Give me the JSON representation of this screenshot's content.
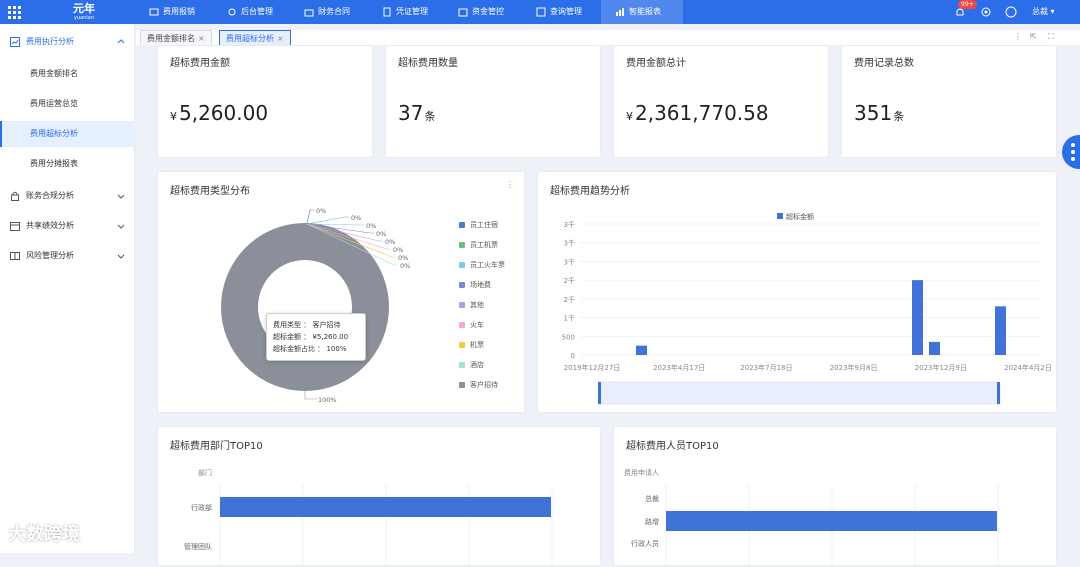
{
  "header": {
    "logo_text": "元年",
    "logo_sub": "yuanian",
    "nav": [
      "费用报销",
      "后台管理",
      "财务合同",
      "凭证管理",
      "资金管控",
      "查询管理",
      "智能报表"
    ],
    "badge": "99+",
    "user": "总裁"
  },
  "sidebar": {
    "groups": [
      {
        "label": "费用执行分析",
        "items": [
          "费用金额排名",
          "费用运营总览",
          "费用超标分析",
          "费用分摊报表"
        ]
      },
      {
        "label": "账务合规分析"
      },
      {
        "label": "共享绩效分析"
      },
      {
        "label": "风险管理分析"
      }
    ]
  },
  "tabs": [
    "费用金额排名",
    "费用超标分析"
  ],
  "kpis": [
    {
      "title": "超标费用金额",
      "currency": "¥",
      "value": "5,260.00",
      "unit": ""
    },
    {
      "title": "超标费用数量",
      "currency": "",
      "value": "37",
      "unit": "条"
    },
    {
      "title": "费用金额总计",
      "currency": "¥",
      "value": "2,361,770.58",
      "unit": ""
    },
    {
      "title": "费用记录总数",
      "currency": "",
      "value": "351",
      "unit": "条"
    }
  ],
  "titles": {
    "type_dist": "超标费用类型分布",
    "trend": "超标费用趋势分析",
    "dept": "超标费用部门TOP10",
    "person": "超标费用人员TOP10"
  },
  "tooltip": {
    "rows": [
      [
        "费用类型",
        "客户招待"
      ],
      [
        "超标金额",
        "¥5,260.00"
      ],
      [
        "超标金额占比",
        "100%"
      ]
    ]
  },
  "chart_data": [
    {
      "type": "pie",
      "title": "超标费用类型分布",
      "categories": [
        "员工住宿",
        "员工机票",
        "员工火车票",
        "场地费",
        "其他",
        "火车",
        "机票",
        "酒店",
        "客户招待"
      ],
      "values": [
        0,
        0,
        0,
        0,
        0,
        0,
        0,
        0,
        5260
      ],
      "slice_labels": [
        "0%",
        "0%",
        "0%",
        "0%",
        "0%",
        "0%",
        "0%",
        "0%",
        "100%"
      ],
      "colors": [
        "#4a7bd0",
        "#6cbf84",
        "#7ecbe6",
        "#7a86d8",
        "#b79be0",
        "#f3a6d4",
        "#f2c94c",
        "#a6e0d2",
        "#8a8f99"
      ],
      "legend": "right"
    },
    {
      "type": "bar",
      "title": "超标费用趋势分析",
      "series": [
        {
          "name": "超标金额",
          "color": "#3f73d6"
        }
      ],
      "ytick_labels": [
        "0",
        "500",
        "1千",
        "2千",
        "2千",
        "3千",
        "3千",
        "3千"
      ],
      "xtick_labels": [
        "2019年12月27日",
        "2023年4月17日",
        "2023年7月18日",
        "2023年9月8日",
        "2023年12月9日",
        "2024年4月2日"
      ],
      "bars": [
        {
          "x": "2023年1月",
          "value": 250
        },
        {
          "x": "2023年12月",
          "value": 2000
        },
        {
          "x": "2024年1月",
          "value": 350
        },
        {
          "x": "2024年4月",
          "value": 1300
        }
      ],
      "ylim": [
        0,
        3500
      ],
      "grid": true,
      "legend": "top"
    },
    {
      "type": "bar",
      "title": "超标费用部门TOP10",
      "ylabel": "部门",
      "categories": [
        "行政部",
        "管理团队"
      ],
      "values": [
        1.0,
        0
      ],
      "orientation": "horizontal"
    },
    {
      "type": "bar",
      "title": "超标费用人员TOP10",
      "ylabel": "费用申请人",
      "categories": [
        "总裁",
        "路增",
        "行政人员"
      ],
      "values": [
        0,
        1.0,
        0
      ],
      "orientation": "horizontal"
    }
  ],
  "watermark": "大数跨境"
}
